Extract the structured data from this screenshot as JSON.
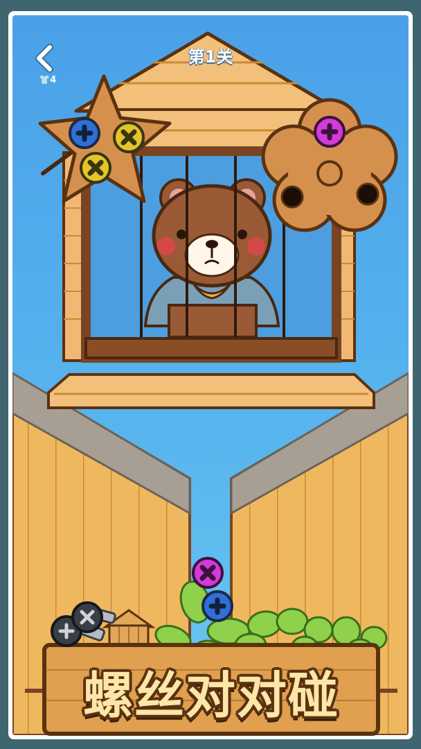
{
  "game": {
    "level_title": "第1关",
    "lives_count": "4",
    "title_logo": "螺丝对对碰"
  },
  "icons": {
    "back": "chevron-left-icon",
    "lives": "shirt-icon"
  },
  "screws": [
    {
      "id": "blue",
      "color": "#2f6fd6",
      "location": "star-plank"
    },
    {
      "id": "yellow-1",
      "color": "#e3c52a",
      "location": "star-plank"
    },
    {
      "id": "yellow-2",
      "color": "#e3c52a",
      "location": "star-plank"
    },
    {
      "id": "magenta-1",
      "color": "#d43ad8",
      "location": "flower-plank"
    },
    {
      "id": "magenta-2",
      "color": "#d43ad8",
      "location": "bottom-pit"
    },
    {
      "id": "blue-2",
      "color": "#2f6fd6",
      "location": "bottom-pit"
    },
    {
      "id": "dark-1",
      "color": "#3a3f47",
      "location": "logo-decoration"
    },
    {
      "id": "dark-2",
      "color": "#3a3f47",
      "location": "logo-decoration"
    }
  ],
  "colors": {
    "sky": "#58b6ee",
    "wood_light": "#f2c07a",
    "wood_dark": "#7a4424",
    "plank": "#d6904e",
    "bear": "#9a5a36"
  }
}
